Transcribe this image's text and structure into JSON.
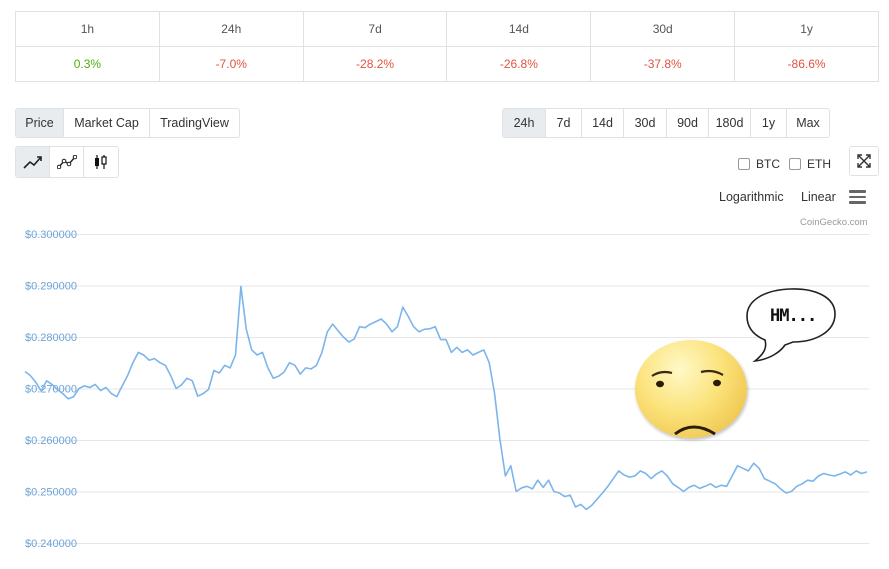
{
  "performance": {
    "headers": [
      "1h",
      "24h",
      "7d",
      "14d",
      "30d",
      "1y"
    ],
    "values": [
      "0.3%",
      "-7.0%",
      "-28.2%",
      "-26.8%",
      "-37.8%",
      "-86.6%"
    ],
    "colors": {
      "positive": "#4eaf0a",
      "negative": "#e15241"
    }
  },
  "view_tabs": [
    "Price",
    "Market Cap",
    "TradingView"
  ],
  "active_view": "Price",
  "ranges": [
    "24h",
    "7d",
    "14d",
    "30d",
    "90d",
    "180d",
    "1y",
    "Max"
  ],
  "active_range": "24h",
  "chart_types": [
    "line-chart-icon",
    "point-line-icon",
    "candlestick-icon"
  ],
  "compare": {
    "btc": "BTC",
    "eth": "ETH"
  },
  "scale": {
    "log": "Logarithmic",
    "linear": "Linear"
  },
  "credit": "CoinGecko.com",
  "overlay": {
    "bubble_text": "HM..."
  },
  "chart_data": {
    "type": "line",
    "y_ticks": [
      "$0.300000",
      "$0.290000",
      "$0.280000",
      "$0.270000",
      "$0.260000",
      "$0.250000",
      "$0.240000"
    ],
    "ylim": [
      0.24,
      0.3
    ],
    "grid": true,
    "line_color": "#7cb5ec",
    "values": [
      0.2733,
      0.2725,
      0.2712,
      0.2695,
      0.2715,
      0.2708,
      0.2698,
      0.269,
      0.268,
      0.2684,
      0.27,
      0.2705,
      0.2702,
      0.2708,
      0.2696,
      0.2702,
      0.269,
      0.2684,
      0.2705,
      0.2725,
      0.275,
      0.277,
      0.2765,
      0.2755,
      0.2758,
      0.275,
      0.2745,
      0.2725,
      0.27,
      0.2707,
      0.272,
      0.2715,
      0.2685,
      0.269,
      0.2698,
      0.2735,
      0.273,
      0.2745,
      0.274,
      0.2765,
      0.2898,
      0.2815,
      0.2775,
      0.2765,
      0.277,
      0.274,
      0.272,
      0.2724,
      0.2732,
      0.275,
      0.2745,
      0.2728,
      0.274,
      0.2738,
      0.2745,
      0.277,
      0.281,
      0.2825,
      0.2812,
      0.28,
      0.279,
      0.2796,
      0.282,
      0.2818,
      0.2825,
      0.283,
      0.2835,
      0.2825,
      0.281,
      0.282,
      0.2858,
      0.284,
      0.282,
      0.281,
      0.2815,
      0.2816,
      0.282,
      0.2795,
      0.2795,
      0.277,
      0.278,
      0.277,
      0.2775,
      0.2765,
      0.277,
      0.2775,
      0.275,
      0.269,
      0.26,
      0.253,
      0.255,
      0.25,
      0.2507,
      0.251,
      0.2505,
      0.2522,
      0.2508,
      0.2522,
      0.25,
      0.2497,
      0.249,
      0.2493,
      0.247,
      0.2475,
      0.2465,
      0.2473,
      0.2485,
      0.2497,
      0.251,
      0.2525,
      0.254,
      0.2532,
      0.2528,
      0.253,
      0.254,
      0.2535,
      0.2525,
      0.2534,
      0.254,
      0.253,
      0.2515,
      0.2508,
      0.25,
      0.2508,
      0.2512,
      0.2506,
      0.251,
      0.2515,
      0.2508,
      0.2512,
      0.251,
      0.253,
      0.255,
      0.2545,
      0.254,
      0.2555,
      0.2545,
      0.2525,
      0.252,
      0.2515,
      0.2505,
      0.2497,
      0.25,
      0.251,
      0.2515,
      0.2522,
      0.252,
      0.253,
      0.2535,
      0.2532,
      0.253,
      0.2534,
      0.2538,
      0.2532,
      0.254,
      0.2535,
      0.2538
    ]
  }
}
